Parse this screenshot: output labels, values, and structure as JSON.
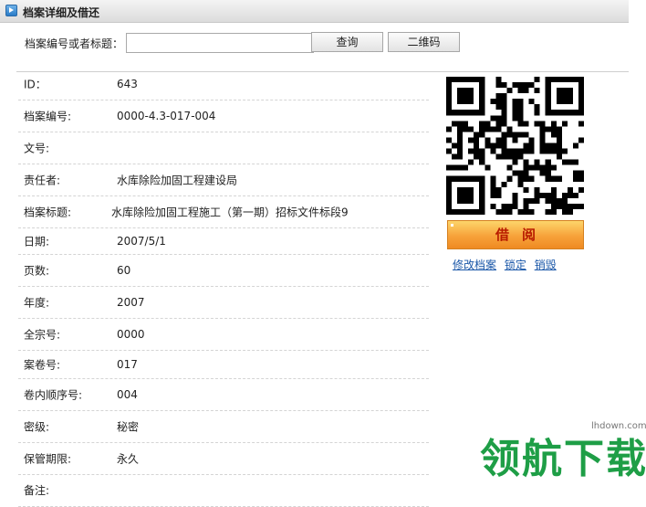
{
  "header": {
    "title": "档案详细及借还",
    "icon": "arrow-right-icon"
  },
  "search": {
    "label": "档案编号或者标题：",
    "value": "",
    "button": "查询",
    "qr_button": "二维码"
  },
  "fields": [
    {
      "label": "ID：",
      "value": "643"
    },
    {
      "label": "档案编号:",
      "value": "0000-4.3-017-004"
    },
    {
      "label": "文号:",
      "value": ""
    },
    {
      "label": "责任者:",
      "value": "水库除险加固工程建设局"
    },
    {
      "label": "档案标题:",
      "value": "水库除险加固工程施工（第一期）招标文件标段9"
    },
    {
      "label": "日期:",
      "value": "2007/5/1"
    },
    {
      "label": "页数:",
      "value": "60"
    },
    {
      "label": "年度:",
      "value": "2007"
    },
    {
      "label": "全宗号:",
      "value": "0000"
    },
    {
      "label": "案卷号:",
      "value": "017"
    },
    {
      "label": "卷内顺序号:",
      "value": "004"
    },
    {
      "label": "密级:",
      "value": "秘密"
    },
    {
      "label": "保管期限:",
      "value": "永久"
    },
    {
      "label": "备注:",
      "value": ""
    }
  ],
  "actions": {
    "borrow": "借阅",
    "edit": "修改档案",
    "lock": "锁定",
    "destroy": "销毁"
  },
  "watermark": {
    "url": "lhdown.com",
    "brand": "领航下载"
  },
  "colors": {
    "borrow_text": "#b81b00",
    "borrow_bg": "#f7a23a",
    "link": "#1a57a8",
    "watermark": "#1e9e46"
  }
}
